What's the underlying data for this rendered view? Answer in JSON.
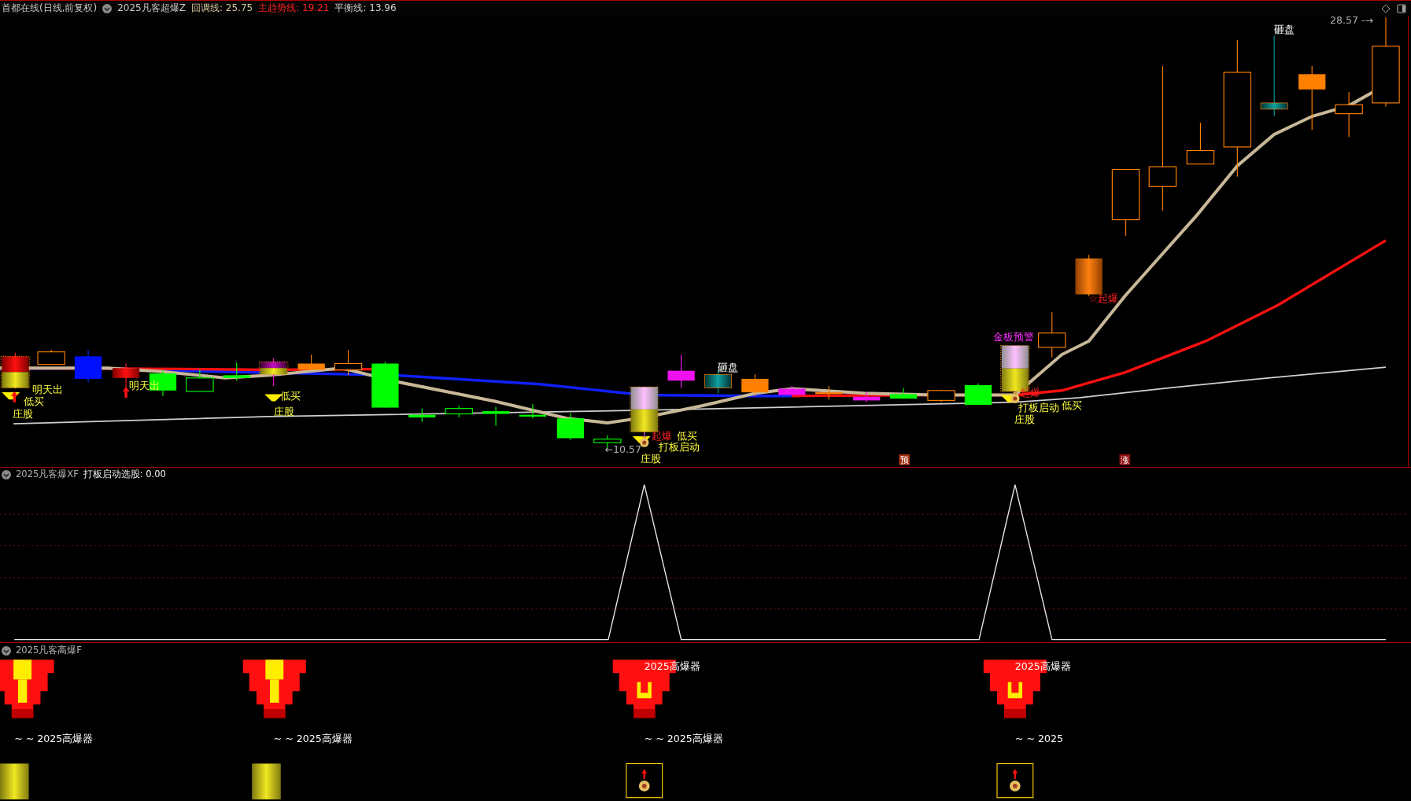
{
  "header": {
    "title": "首都在线(日线,前复权)",
    "indicator": "2025凡客超爆Z",
    "readings": [
      {
        "text": "回调线: 25.75",
        "color": "#d8c8a0"
      },
      {
        "text": "主趋势线: 19.21",
        "color": "#ff2020"
      },
      {
        "text": "平衡线: 13.96",
        "color": "#d0d0d0"
      }
    ]
  },
  "main_chart": {
    "labels": [
      {
        "text": "明天出",
        "kind": "sell"
      },
      {
        "text": "低买",
        "kind": "buy"
      },
      {
        "text": "庄股",
        "kind": "stock"
      },
      {
        "text": "明天出",
        "kind": "sell"
      },
      {
        "text": "低买",
        "kind": "buy"
      },
      {
        "text": "庄股",
        "kind": "stock"
      },
      {
        "text": "砸盘",
        "kind": "dump"
      },
      {
        "text": "←10.57",
        "kind": "price"
      },
      {
        "text": "起爆",
        "kind": "burst"
      },
      {
        "text": "低买",
        "kind": "buy"
      },
      {
        "text": "打板启动",
        "kind": "board"
      },
      {
        "text": "庄股",
        "kind": "stock"
      },
      {
        "text": "预",
        "kind": "marker"
      },
      {
        "text": "金板预警",
        "kind": "alert"
      },
      {
        "text": "起爆",
        "kind": "burst"
      },
      {
        "text": "打板启动",
        "kind": "board"
      },
      {
        "text": "低买",
        "kind": "buy"
      },
      {
        "text": "庄股",
        "kind": "stock"
      },
      {
        "text": "☆起爆",
        "kind": "burst"
      },
      {
        "text": "涨",
        "kind": "marker"
      },
      {
        "text": "砸盘",
        "kind": "dump"
      },
      {
        "text": "28.57 -→",
        "kind": "price"
      }
    ]
  },
  "panel_1": {
    "title": "2025凡客爆XF",
    "reading": "打板启动选股: 0.00"
  },
  "panel_2": {
    "title": "2025凡客高爆F",
    "signals": [
      {
        "bottom_label": "~ ~ 2025高爆器",
        "kind": "bar"
      },
      {
        "bottom_label": "~ ~ 2025高爆器",
        "kind": "bar"
      },
      {
        "top_label": "2025高爆器",
        "bottom_label": "~ ~ 2025高爆器",
        "kind": "bag"
      },
      {
        "top_label": "2025高爆器",
        "bottom_label": "~ ~ 2025",
        "kind": "bag"
      }
    ]
  }
}
